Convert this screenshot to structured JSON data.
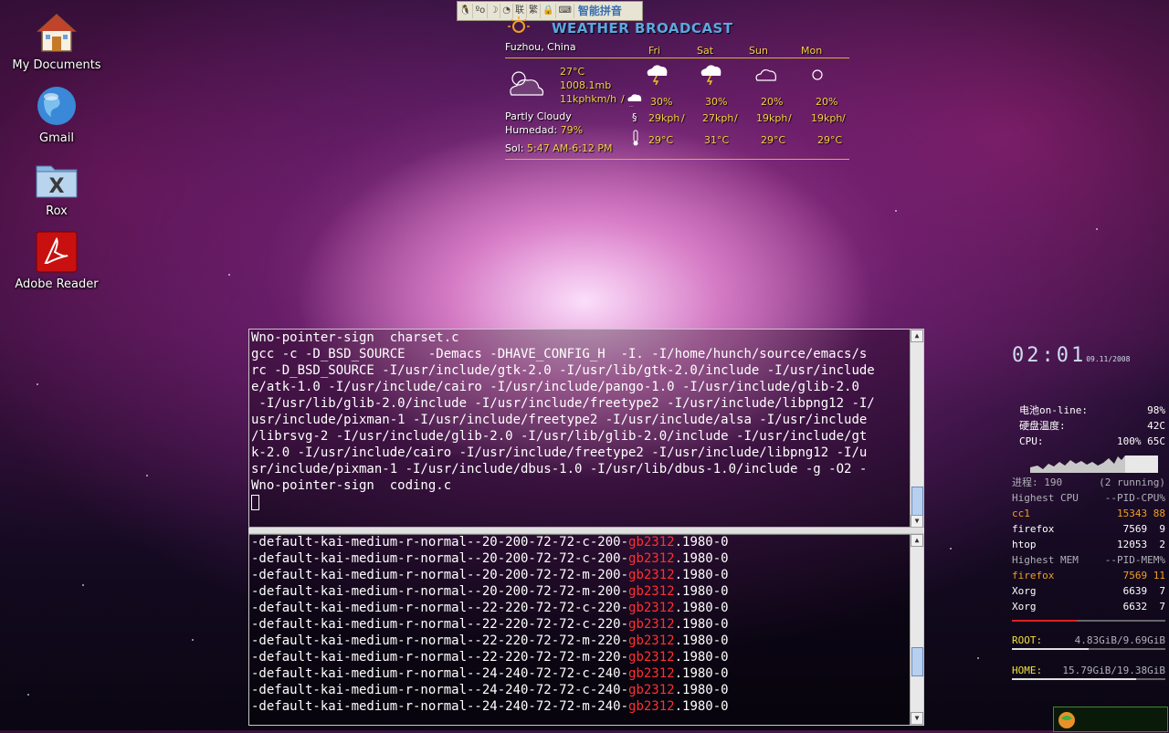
{
  "desktop": {
    "icons": [
      {
        "label": "My Documents"
      },
      {
        "label": "Gmail"
      },
      {
        "label": "Rox"
      },
      {
        "label": "Adobe Reader"
      }
    ]
  },
  "ime": {
    "name": "智能拼音",
    "buttons": [
      "联",
      "繁"
    ]
  },
  "weather": {
    "title": "WEATHER BROADCAST",
    "location": "Fuzhou, China",
    "current": {
      "temp": "27°C",
      "pressure": "1008.1mb",
      "wind": "11kphkm/h",
      "condition": "Partly Cloudy",
      "humidity_label": "Humedad:",
      "humidity_value": "79%",
      "sun_label": "Sol:",
      "sun_value": "5:47 AM-6:12 PM"
    },
    "forecast": [
      {
        "day": "Fri",
        "precip": "30%",
        "wind": "29kph",
        "temp": "29°C"
      },
      {
        "day": "Sat",
        "precip": "30%",
        "wind": "27kph",
        "temp": "31°C"
      },
      {
        "day": "Sun",
        "precip": "20%",
        "wind": "19kph",
        "temp": "29°C"
      },
      {
        "day": "Mon",
        "precip": "20%",
        "wind": "19kph",
        "temp": "29°C"
      }
    ]
  },
  "terminal_top": {
    "lines": [
      "Wno-pointer-sign  charset.c",
      "gcc -c -D_BSD_SOURCE   -Demacs -DHAVE_CONFIG_H  -I. -I/home/hunch/source/emacs/s",
      "rc -D_BSD_SOURCE -I/usr/include/gtk-2.0 -I/usr/lib/gtk-2.0/include -I/usr/include",
      "e/atk-1.0 -I/usr/include/cairo -I/usr/include/pango-1.0 -I/usr/include/glib-2.0",
      " -I/usr/lib/glib-2.0/include -I/usr/include/freetype2 -I/usr/include/libpng12 -I/",
      "usr/include/pixman-1 -I/usr/include/freetype2 -I/usr/include/alsa -I/usr/include",
      "/librsvg-2 -I/usr/include/glib-2.0 -I/usr/lib/glib-2.0/include -I/usr/include/gt",
      "k-2.0 -I/usr/include/cairo -I/usr/include/freetype2 -I/usr/include/libpng12 -I/u",
      "sr/include/pixman-1 -I/usr/include/dbus-1.0 -I/usr/lib/dbus-1.0/include -g -O2 -",
      "Wno-pointer-sign  coding.c"
    ]
  },
  "terminal_bottom": {
    "lines": [
      {
        "pre": "-default-kai-medium-r-normal--20-200-72-72-c-200-",
        "hl": "gb2312",
        "post": ".1980-0"
      },
      {
        "pre": "-default-kai-medium-r-normal--20-200-72-72-c-200-",
        "hl": "gb2312",
        "post": ".1980-0"
      },
      {
        "pre": "-default-kai-medium-r-normal--20-200-72-72-m-200-",
        "hl": "gb2312",
        "post": ".1980-0"
      },
      {
        "pre": "-default-kai-medium-r-normal--20-200-72-72-m-200-",
        "hl": "gb2312",
        "post": ".1980-0"
      },
      {
        "pre": "-default-kai-medium-r-normal--22-220-72-72-c-220-",
        "hl": "gb2312",
        "post": ".1980-0"
      },
      {
        "pre": "-default-kai-medium-r-normal--22-220-72-72-c-220-",
        "hl": "gb2312",
        "post": ".1980-0"
      },
      {
        "pre": "-default-kai-medium-r-normal--22-220-72-72-m-220-",
        "hl": "gb2312",
        "post": ".1980-0"
      },
      {
        "pre": "-default-kai-medium-r-normal--22-220-72-72-m-220-",
        "hl": "gb2312",
        "post": ".1980-0"
      },
      {
        "pre": "-default-kai-medium-r-normal--24-240-72-72-c-240-",
        "hl": "gb2312",
        "post": ".1980-0"
      },
      {
        "pre": "-default-kai-medium-r-normal--24-240-72-72-c-240-",
        "hl": "gb2312",
        "post": ".1980-0"
      },
      {
        "pre": "-default-kai-medium-r-normal--24-240-72-72-m-240-",
        "hl": "gb2312",
        "post": ".1980-0"
      }
    ]
  },
  "conky": {
    "time": "02:01",
    "date": "09.11/2008",
    "battery_label": "电池on-line:",
    "battery_value": "98%",
    "disk_temp_label": "硬盘温度:",
    "disk_temp_value": "42C",
    "cpu_label": "CPU:",
    "cpu_value": "100% 65C",
    "proc_label": "进程:",
    "proc_count": "190",
    "proc_running": "(2 running)",
    "high_cpu_label": "Highest CPU",
    "high_cpu_cols": "--PID-CPU%",
    "cpu_procs": [
      {
        "name": "cc1",
        "pid": "15343",
        "val": "88"
      },
      {
        "name": "firefox",
        "pid": "7569",
        "val": "9"
      },
      {
        "name": "htop",
        "pid": "12053",
        "val": "2"
      }
    ],
    "high_mem_label": "Highest MEM",
    "high_mem_cols": "--PID-MEM%",
    "mem_procs": [
      {
        "name": "firefox",
        "pid": "7569",
        "val": "11"
      },
      {
        "name": "Xorg",
        "pid": "6639",
        "val": "7"
      },
      {
        "name": "Xorg",
        "pid": "6632",
        "val": "7"
      }
    ],
    "mem_usage": 0.42,
    "root_label": "ROOT:",
    "root_value": "4.83GiB/9.69GiB",
    "root_usage": 0.5,
    "home_label": "HOME:",
    "home_value": "15.79GiB/19.38GiB",
    "home_usage": 0.81
  }
}
